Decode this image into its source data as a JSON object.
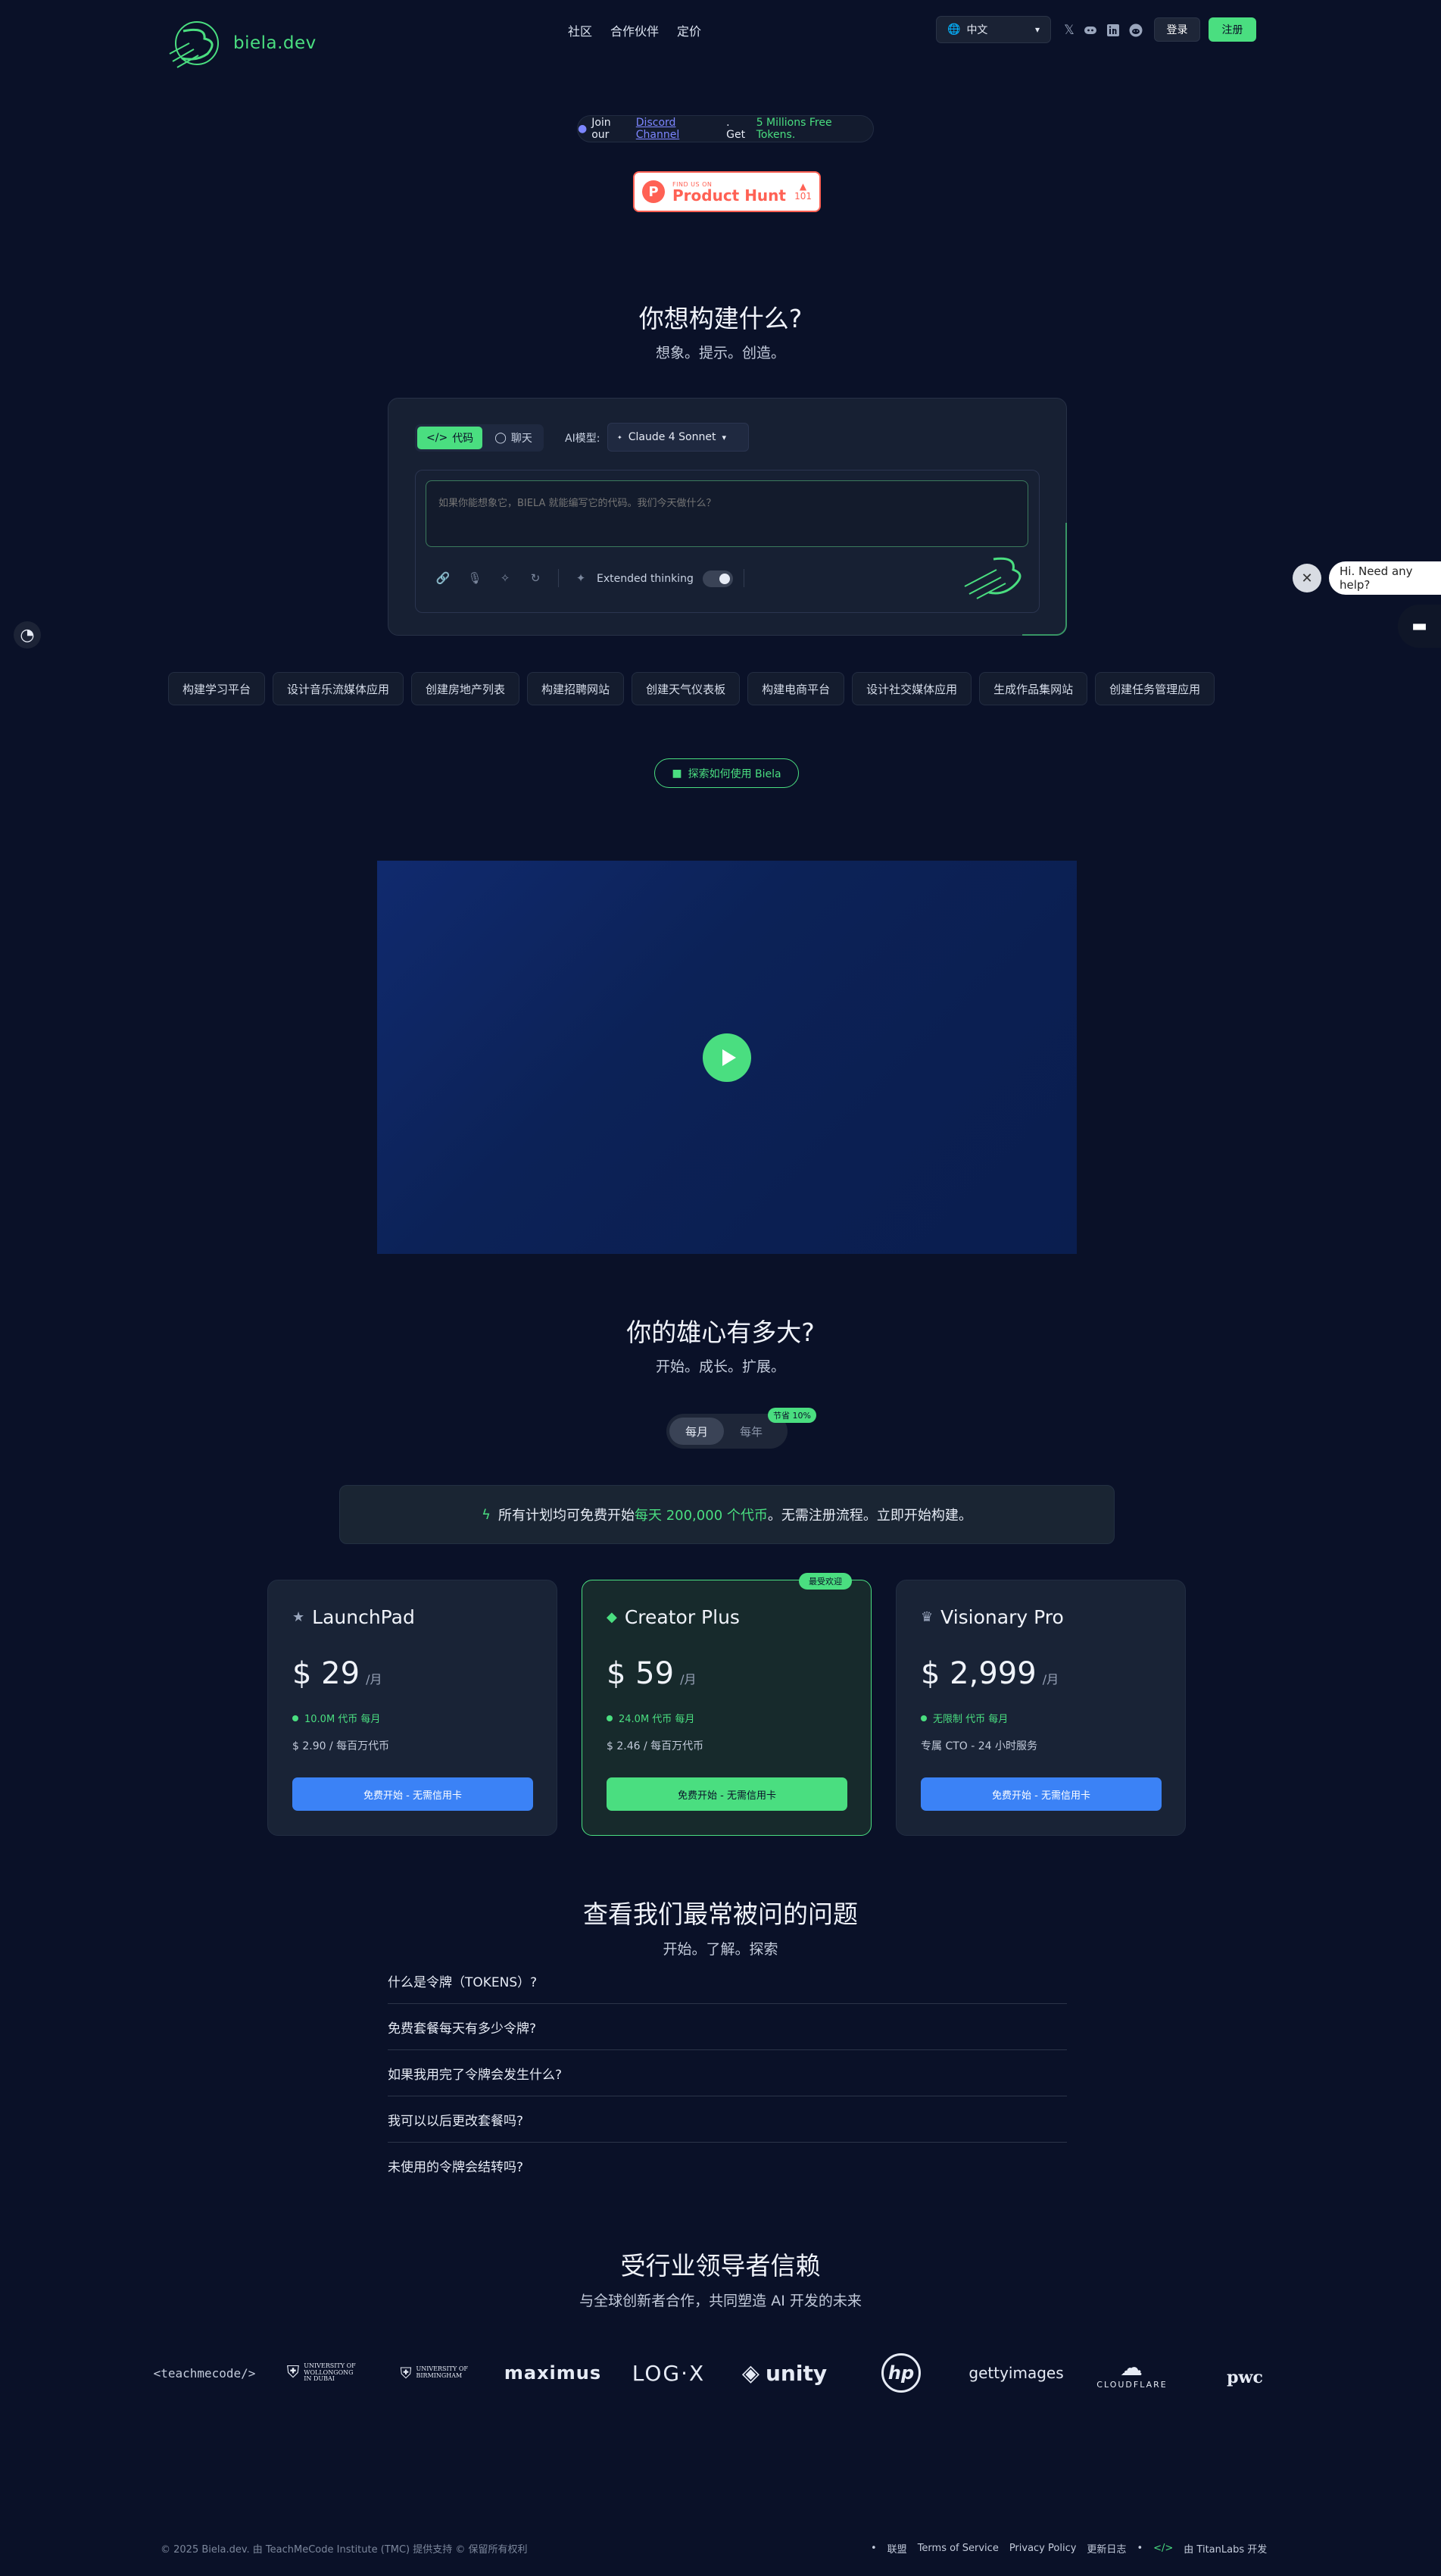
{
  "header": {
    "logo_text": "biela.dev",
    "nav": [
      "社区",
      "合作伙伴",
      "定价"
    ],
    "language": "中文",
    "login": "登录",
    "signup": "注册"
  },
  "discord": {
    "prefix": "Join our",
    "link": "Discord Channel",
    "middle": ". Get",
    "highlight": "5 Millions Free Tokens."
  },
  "product_hunt": {
    "small": "FIND US ON",
    "big": "Product Hunt",
    "votes": "101"
  },
  "hero": {
    "title": "你想构建什么?",
    "subtitle": "想象。提示。创造。"
  },
  "prompt": {
    "tab_code": "代码",
    "tab_chat": "聊天",
    "model_label": "AI模型:",
    "model_value": "Claude 4 Sonnet",
    "placeholder": "如果你能想象它，BIELA 就能编写它的代码。我们今天做什么？",
    "extended": "Extended thinking"
  },
  "chips": [
    "构建学习平台",
    "设计音乐流媒体应用",
    "创建房地产列表",
    "构建招聘网站",
    "创建天气仪表板",
    "构建电商平台",
    "设计社交媒体应用",
    "生成作品集网站",
    "创建任务管理应用"
  ],
  "explore": "探索如何使用 Biela",
  "pricing": {
    "title": "你的雄心有多大?",
    "subtitle": "开始。成长。扩展。",
    "monthly": "每月",
    "yearly": "每年",
    "save": "节省 10%",
    "banner_prefix": "所有计划均可免费开始",
    "banner_highlight": "每天 200,000 个代币",
    "banner_suffix": "。无需注册流程。立即开始构建。",
    "popular": "最受欢迎",
    "plans": [
      {
        "name": "LaunchPad",
        "price": "$ 29",
        "per": "/月",
        "tokens": "10.0M 代币 每月",
        "rate": "$ 2.90 / 每百万代币",
        "button": "免费开始 - 无需信用卡"
      },
      {
        "name": "Creator Plus",
        "price": "$ 59",
        "per": "/月",
        "tokens": "24.0M 代币 每月",
        "rate": "$ 2.46 / 每百万代币",
        "button": "免费开始 - 无需信用卡"
      },
      {
        "name": "Visionary Pro",
        "price": "$ 2,999",
        "per": "/月",
        "tokens": "无限制 代币 每月",
        "rate": "专属 CTO - 24 小时服务",
        "button": "免费开始 - 无需信用卡"
      }
    ]
  },
  "faq": {
    "title": "查看我们最常被问的问题",
    "subtitle": "开始。了解。探索",
    "items": [
      "什么是令牌（TOKENS）?",
      "免费套餐每天有多少令牌?",
      "如果我用完了令牌会发生什么?",
      "我可以以后更改套餐吗?",
      "未使用的令牌会结转吗?"
    ]
  },
  "trust": {
    "title": "受行业领导者信赖",
    "subtitle": "与全球创新者合作，共同塑造 AI 开发的未来",
    "brands": [
      "<teachmecode/>",
      "UNIVERSITY OF WOLLONGONG IN DUBAI",
      "UNIVERSITY OF BIRMINGHAM",
      "maximus",
      "LOG·X",
      "unity",
      "hp",
      "gettyimages",
      "CLOUDFLARE",
      "pwc"
    ]
  },
  "footer": {
    "copyright": "© 2025 Biela.dev. 由 TeachMeCode Institute (TMC) 提供支持 © 保留所有权利",
    "links": [
      "联盟",
      "Terms of Service",
      "Privacy Policy",
      "更新日志"
    ],
    "built_by": "由 TitanLabs 开发"
  },
  "chat": {
    "bubble": "Hi. Need any help?"
  },
  "icons": {
    "globe": "globe-icon",
    "x": "x-icon",
    "discord": "discord-icon",
    "linkedin": "linkedin-icon",
    "reddit": "reddit-icon",
    "cookie": "cookie-icon",
    "play": "play-icon",
    "chat": "chat-icon"
  },
  "colors": {
    "background": "#0a1128",
    "accent": "#4ade80",
    "blue_button": "#3b82f6"
  }
}
